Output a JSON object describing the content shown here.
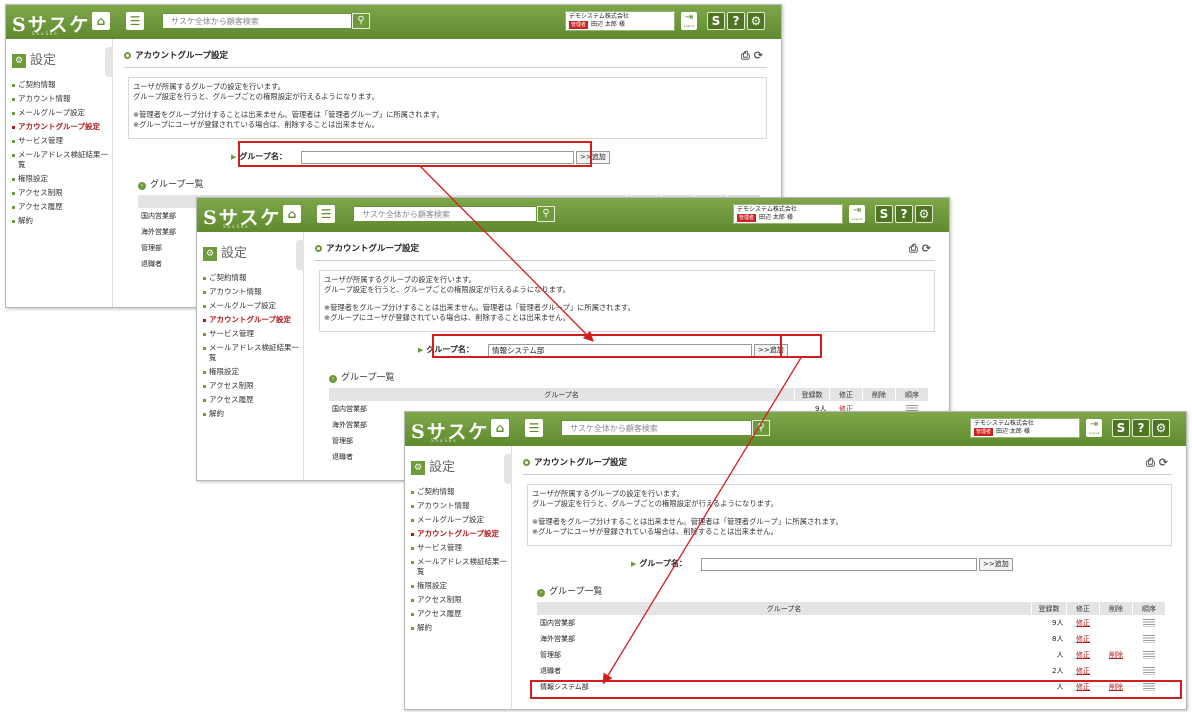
{
  "app": {
    "logo": "Sサスケ",
    "logo_sub": "SaaSke",
    "search_placeholder": "サスケ全体から顧客検索",
    "company": "デモシステム株式会社",
    "admin_badge": "管理者",
    "user": "田辺 太郎 様",
    "logout": "Logout",
    "help": "?",
    "s_icon": "S"
  },
  "sidebar": {
    "title": "設定",
    "items": [
      "ご契約情報",
      "アカウント情報",
      "メールグループ設定",
      "アカウントグループ設定",
      "サービス管理",
      "メールアドレス検証結果一覧",
      "権限設定",
      "アクセス制限",
      "アクセス履歴",
      "解約"
    ],
    "active_index": 3
  },
  "page": {
    "title": "アカウントグループ設定",
    "desc_line1": "ユーザが所属するグループの設定を行います。",
    "desc_line2": "グループ設定を行うと、グループごとの権限設定が行えるようになります。",
    "desc_line3": "※管理者をグループ分けすることは出来ません。管理者は「管理者グループ」に所属されます。",
    "desc_line4": "※グループにユーザが登録されている場合は、削除することは出来ません。",
    "group_name_label": "グループ名：",
    "add_button": ">>追加",
    "group_list_title": "グループ一覧"
  },
  "table": {
    "headers": [
      "グループ名",
      "登録数",
      "修正",
      "削除",
      "順序"
    ],
    "edit_label": "修正",
    "delete_label": "削除"
  },
  "screens": [
    {
      "input_value": "",
      "rows": [
        {
          "name": "国内営業部",
          "count": "9人",
          "deletable": false
        },
        {
          "name": "海外営業部",
          "count": "8人",
          "deletable": false
        },
        {
          "name": "管理部",
          "count": "人",
          "deletable": true
        },
        {
          "name": "退職者",
          "count": "2人",
          "deletable": false
        }
      ]
    },
    {
      "input_value": "情報システム部",
      "rows": [
        {
          "name": "国内営業部",
          "count": "9人",
          "deletable": false
        },
        {
          "name": "海外営業部",
          "count": "8人",
          "deletable": false
        },
        {
          "name": "管理部",
          "count": "人",
          "deletable": true
        },
        {
          "name": "退職者",
          "count": "2人",
          "deletable": false
        }
      ]
    },
    {
      "input_value": "",
      "rows": [
        {
          "name": "国内営業部",
          "count": "9人",
          "deletable": false
        },
        {
          "name": "海外営業部",
          "count": "8人",
          "deletable": false
        },
        {
          "name": "管理部",
          "count": "人",
          "deletable": true
        },
        {
          "name": "退職者",
          "count": "2人",
          "deletable": false
        },
        {
          "name": "情報システム部",
          "count": "人",
          "deletable": true
        }
      ]
    }
  ],
  "colors": {
    "header_green": "#6d9a3a",
    "highlight_red": "#d41e1e",
    "link_red": "#b01818"
  }
}
